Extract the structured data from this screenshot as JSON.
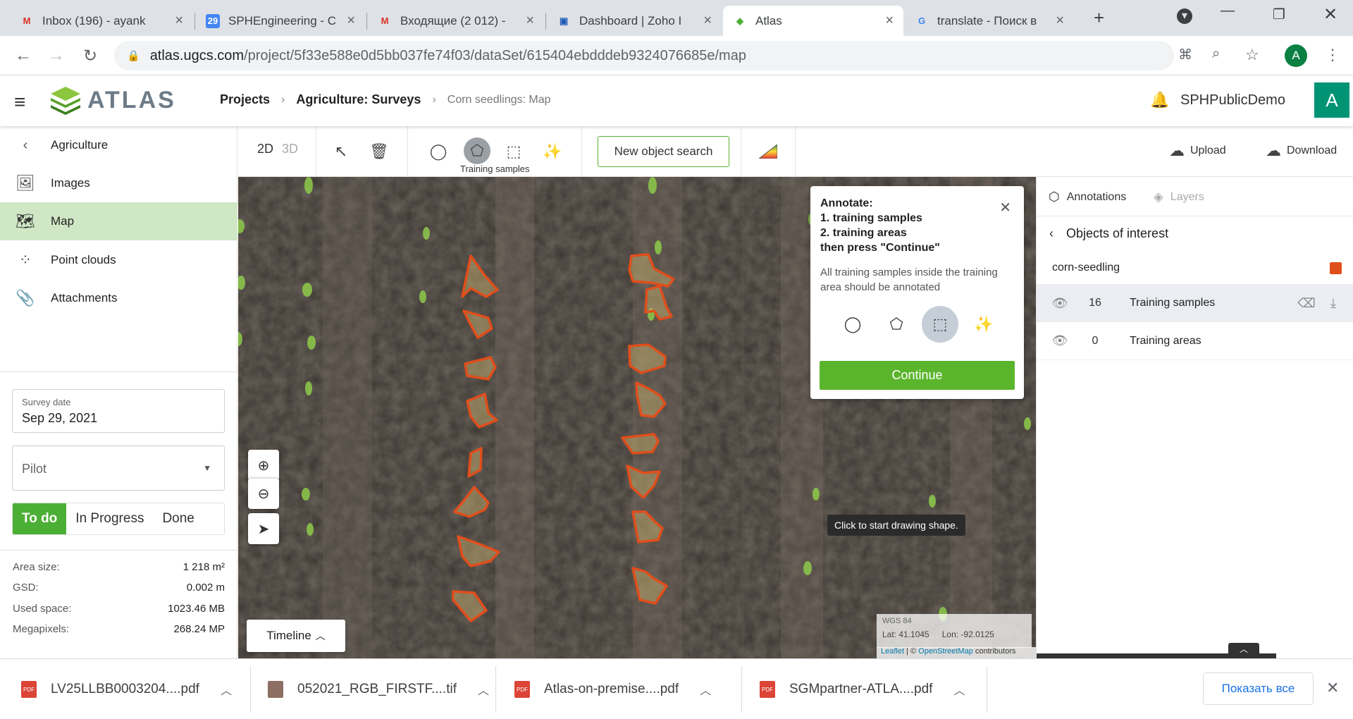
{
  "browser": {
    "tabs": [
      {
        "title": "Inbox (196) - ayank",
        "favicon": "gmail-icon"
      },
      {
        "title": "SPHEngineering - C",
        "favicon": "calendar-icon"
      },
      {
        "title": "Входящие (2 012) -",
        "favicon": "gmail-icon"
      },
      {
        "title": "Dashboard | Zoho I",
        "favicon": "zoho-icon"
      },
      {
        "title": "Atlas",
        "favicon": "atlas-icon"
      },
      {
        "title": "translate - Поиск в",
        "favicon": "google-icon"
      }
    ],
    "active_tab": 4,
    "calendar_day": "29",
    "url_host": "atlas.ugcs.com",
    "url_path": "/project/5f33e588e0d5bb037fe74f03/dataSet/615404ebdddeb9324076685e/map",
    "profile_initial": "A"
  },
  "header": {
    "logo_text": "ATLAS",
    "breadcrumbs": [
      "Projects",
      "Agriculture: Surveys",
      "Corn seedlings: Map"
    ],
    "username": "SPHPublicDemo",
    "avatar_initial": "A"
  },
  "sidebar": {
    "back_label": "Agriculture",
    "items": [
      {
        "label": "Images",
        "icon": "images-icon"
      },
      {
        "label": "Map",
        "icon": "map-icon"
      },
      {
        "label": "Point clouds",
        "icon": "point-cloud-icon"
      },
      {
        "label": "Attachments",
        "icon": "paperclip-icon"
      }
    ],
    "active_item": "Map",
    "survey_date_label": "Survey date",
    "survey_date_value": "Sep 29, 2021",
    "pilot_placeholder": "Pilot",
    "status_options": [
      "To do",
      "In Progress",
      "Done"
    ],
    "status_selected": "To do",
    "stats": [
      {
        "label": "Area size:",
        "value": "1 218 m²"
      },
      {
        "label": "GSD:",
        "value": "0.002 m"
      },
      {
        "label": "Used space:",
        "value": "1023.46 MB"
      },
      {
        "label": "Megapixels:",
        "value": "268.24 MP"
      }
    ]
  },
  "toolbar": {
    "mode_2d": "2D",
    "mode_3d": "3D",
    "training_samples_label": "Training samples",
    "new_object_search": "New object search",
    "upload": "Upload",
    "download": "Download"
  },
  "map": {
    "tooltip": "Click to start drawing shape.",
    "timeline": "Timeline",
    "crs": "WGS 84",
    "lat": "Lat: 41.1045",
    "lon": "Lon: -92.0125",
    "attribution_leaflet": "Leaflet",
    "attribution_sep": " | © ",
    "attribution_osm": "OpenStreetMap",
    "attribution_rest": " contributors",
    "annotation_color": "#e04e1b"
  },
  "annotate_popup": {
    "line1": "Annotate:",
    "line2": "1. training samples",
    "line3": "2. training areas",
    "line4": "then press \"Continue\"",
    "note": "All training samples inside the training area should be annotated",
    "continue": "Continue"
  },
  "right_panel": {
    "tab_annotations": "Annotations",
    "tab_layers": "Layers",
    "title": "Objects of interest",
    "class_name": "corn-seedling",
    "class_color": "#e04e1b",
    "rows": [
      {
        "count": "16",
        "label": "Training samples"
      },
      {
        "count": "0",
        "label": "Training areas"
      }
    ]
  },
  "downloads": {
    "files": [
      "LV25LLBB0003204....pdf",
      "052021_RGB_FIRSTF....tif",
      "Atlas-on-premise....pdf",
      "SGMpartner-ATLA....pdf"
    ],
    "show_all": "Показать все"
  }
}
